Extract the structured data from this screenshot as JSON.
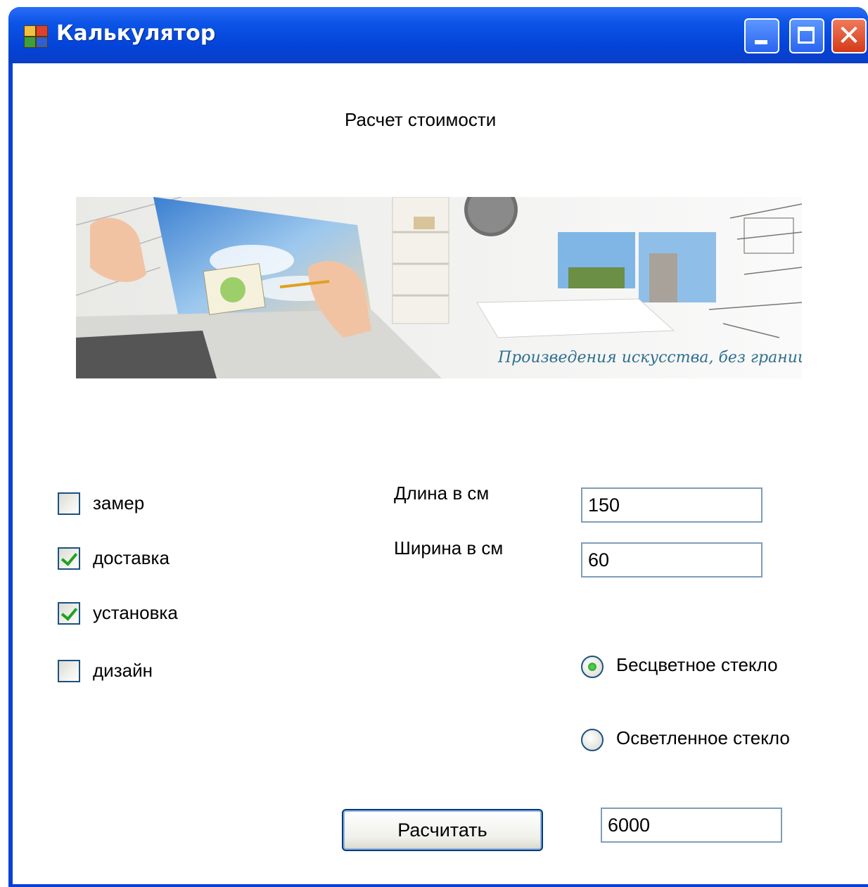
{
  "window": {
    "title": "Калькулятор"
  },
  "form": {
    "heading": "Расчет стоимости",
    "banner": {
      "caption": "Произведения искусства, без границ!"
    },
    "options": [
      {
        "label": "замер",
        "checked": false
      },
      {
        "label": "доставка",
        "checked": true
      },
      {
        "label": "установка",
        "checked": true
      },
      {
        "label": "дизайн",
        "checked": false
      }
    ],
    "length_label": "Длина в см",
    "length_value": "150",
    "width_label": "Ширина в см",
    "width_value": "60",
    "glass": [
      {
        "label": "Бесцветное стекло",
        "selected": true
      },
      {
        "label": "Осветленное стекло",
        "selected": false
      }
    ],
    "calculate_label": "Расчитать",
    "result_value": "6000"
  },
  "colors": {
    "titlebar": "#0443d8",
    "close_button": "#d33a18",
    "check": "#21a121",
    "textbox_border": "#7f9db9"
  }
}
